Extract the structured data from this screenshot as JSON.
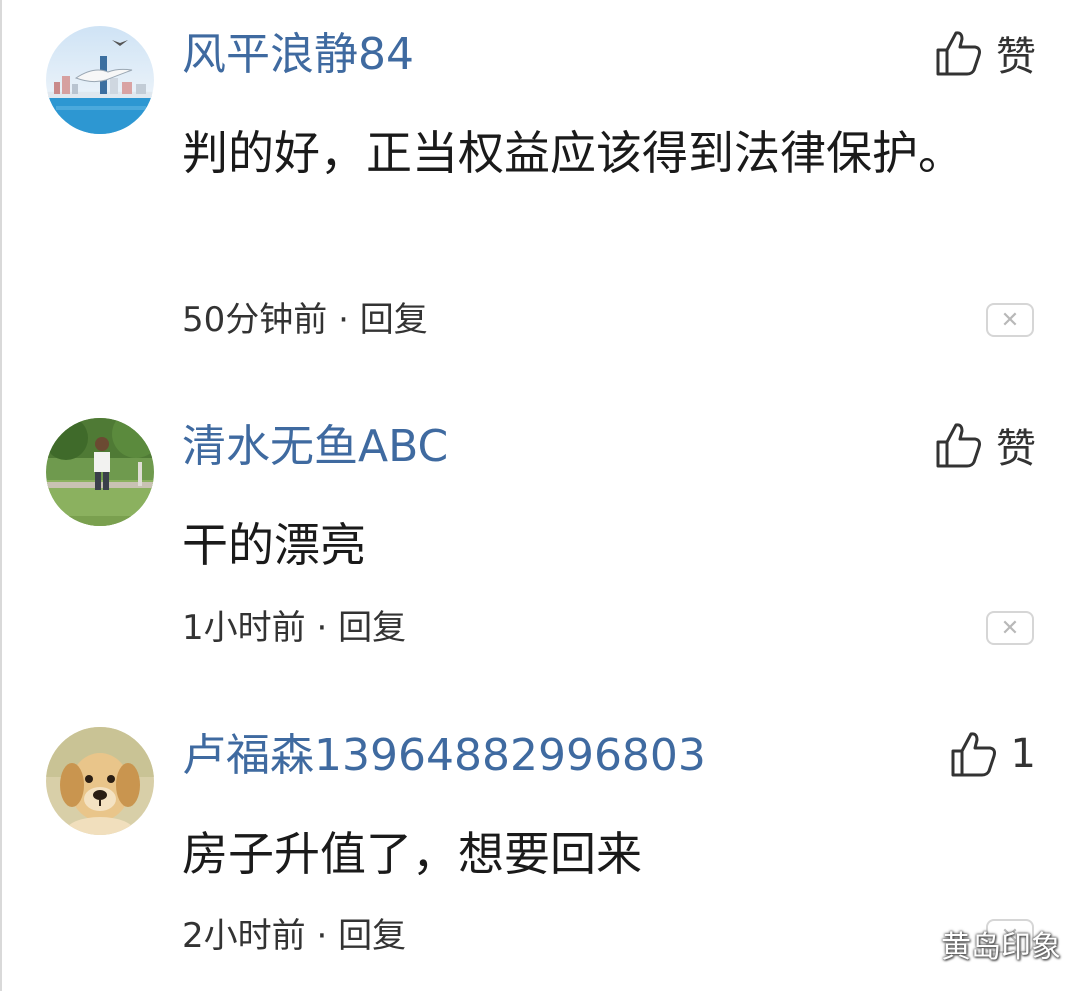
{
  "comments": [
    {
      "username": "风平浪静84",
      "like_label": "赞",
      "text": "判的好，正当权益应该得到法律保护。",
      "time": "50分钟前",
      "separator": "·",
      "reply_label": "回复",
      "close_glyph": "✕"
    },
    {
      "username": "清水无鱼ABC",
      "like_label": "赞",
      "text": "干的漂亮",
      "time": "1小时前",
      "separator": "·",
      "reply_label": "回复",
      "close_glyph": "✕"
    },
    {
      "username": "卢福森13964882996803",
      "like_label": "1",
      "text": "房子升值了，想要回来",
      "time": "2小时前",
      "separator": "·",
      "reply_label": "回复",
      "close_glyph": "✕"
    }
  ],
  "watermark": {
    "text": "黄岛印象",
    "icon": "wechat-icon"
  },
  "colors": {
    "username": "#3f6aa0",
    "text": "#1a1a1a",
    "meta": "#333333",
    "close_border": "#d6d6d6"
  }
}
